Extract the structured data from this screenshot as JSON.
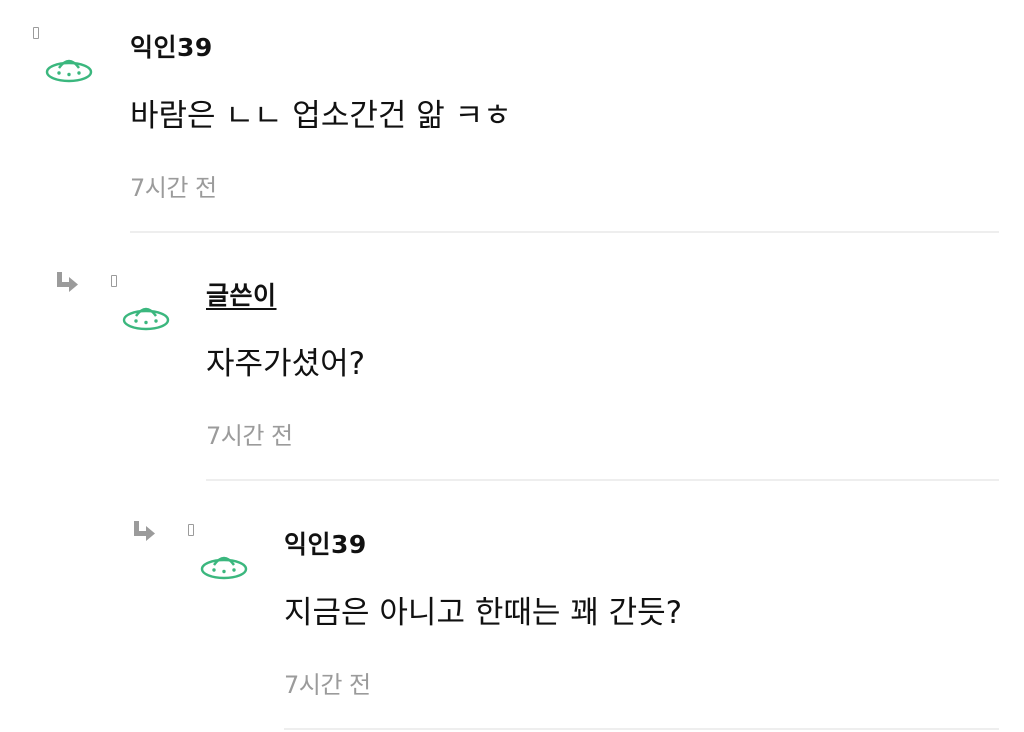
{
  "comments": [
    {
      "author": "익인39",
      "text": "바람은 ㄴㄴ 업소간건 앎 ㅋㅎ",
      "time": "7시간 전",
      "is_reply": false,
      "is_op": false
    },
    {
      "author": "글쓴이",
      "text": "자주가셨어?",
      "time": "7시간 전",
      "is_reply": true,
      "is_op": true
    },
    {
      "author": "익인39",
      "text": "지금은 아니고 한때는 꽤 간듯?",
      "time": "7시간 전",
      "is_reply": true,
      "is_op": false
    }
  ],
  "colors": {
    "avatar_green": "#3bb77e",
    "meta_gray": "#9b9b9b",
    "divider": "#eeeeee"
  },
  "icons": {
    "avatar": "ufo-icon",
    "reply": "reply-arrow-icon",
    "small": "phone-icon"
  }
}
